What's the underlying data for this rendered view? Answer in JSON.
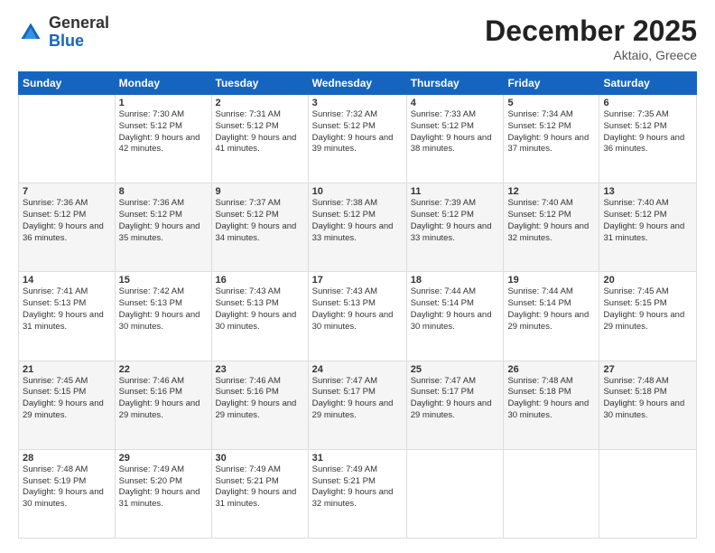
{
  "header": {
    "logo": {
      "general": "General",
      "blue": "Blue"
    },
    "title": "December 2025",
    "location": "Aktaio, Greece"
  },
  "weekdays": [
    "Sunday",
    "Monday",
    "Tuesday",
    "Wednesday",
    "Thursday",
    "Friday",
    "Saturday"
  ],
  "weeks": [
    [
      {
        "day": "",
        "sunrise": "",
        "sunset": "",
        "daylight": ""
      },
      {
        "day": "1",
        "sunrise": "Sunrise: 7:30 AM",
        "sunset": "Sunset: 5:12 PM",
        "daylight": "Daylight: 9 hours and 42 minutes."
      },
      {
        "day": "2",
        "sunrise": "Sunrise: 7:31 AM",
        "sunset": "Sunset: 5:12 PM",
        "daylight": "Daylight: 9 hours and 41 minutes."
      },
      {
        "day": "3",
        "sunrise": "Sunrise: 7:32 AM",
        "sunset": "Sunset: 5:12 PM",
        "daylight": "Daylight: 9 hours and 39 minutes."
      },
      {
        "day": "4",
        "sunrise": "Sunrise: 7:33 AM",
        "sunset": "Sunset: 5:12 PM",
        "daylight": "Daylight: 9 hours and 38 minutes."
      },
      {
        "day": "5",
        "sunrise": "Sunrise: 7:34 AM",
        "sunset": "Sunset: 5:12 PM",
        "daylight": "Daylight: 9 hours and 37 minutes."
      },
      {
        "day": "6",
        "sunrise": "Sunrise: 7:35 AM",
        "sunset": "Sunset: 5:12 PM",
        "daylight": "Daylight: 9 hours and 36 minutes."
      }
    ],
    [
      {
        "day": "7",
        "sunrise": "Sunrise: 7:36 AM",
        "sunset": "Sunset: 5:12 PM",
        "daylight": "Daylight: 9 hours and 36 minutes."
      },
      {
        "day": "8",
        "sunrise": "Sunrise: 7:36 AM",
        "sunset": "Sunset: 5:12 PM",
        "daylight": "Daylight: 9 hours and 35 minutes."
      },
      {
        "day": "9",
        "sunrise": "Sunrise: 7:37 AM",
        "sunset": "Sunset: 5:12 PM",
        "daylight": "Daylight: 9 hours and 34 minutes."
      },
      {
        "day": "10",
        "sunrise": "Sunrise: 7:38 AM",
        "sunset": "Sunset: 5:12 PM",
        "daylight": "Daylight: 9 hours and 33 minutes."
      },
      {
        "day": "11",
        "sunrise": "Sunrise: 7:39 AM",
        "sunset": "Sunset: 5:12 PM",
        "daylight": "Daylight: 9 hours and 33 minutes."
      },
      {
        "day": "12",
        "sunrise": "Sunrise: 7:40 AM",
        "sunset": "Sunset: 5:12 PM",
        "daylight": "Daylight: 9 hours and 32 minutes."
      },
      {
        "day": "13",
        "sunrise": "Sunrise: 7:40 AM",
        "sunset": "Sunset: 5:12 PM",
        "daylight": "Daylight: 9 hours and 31 minutes."
      }
    ],
    [
      {
        "day": "14",
        "sunrise": "Sunrise: 7:41 AM",
        "sunset": "Sunset: 5:13 PM",
        "daylight": "Daylight: 9 hours and 31 minutes."
      },
      {
        "day": "15",
        "sunrise": "Sunrise: 7:42 AM",
        "sunset": "Sunset: 5:13 PM",
        "daylight": "Daylight: 9 hours and 30 minutes."
      },
      {
        "day": "16",
        "sunrise": "Sunrise: 7:43 AM",
        "sunset": "Sunset: 5:13 PM",
        "daylight": "Daylight: 9 hours and 30 minutes."
      },
      {
        "day": "17",
        "sunrise": "Sunrise: 7:43 AM",
        "sunset": "Sunset: 5:13 PM",
        "daylight": "Daylight: 9 hours and 30 minutes."
      },
      {
        "day": "18",
        "sunrise": "Sunrise: 7:44 AM",
        "sunset": "Sunset: 5:14 PM",
        "daylight": "Daylight: 9 hours and 30 minutes."
      },
      {
        "day": "19",
        "sunrise": "Sunrise: 7:44 AM",
        "sunset": "Sunset: 5:14 PM",
        "daylight": "Daylight: 9 hours and 29 minutes."
      },
      {
        "day": "20",
        "sunrise": "Sunrise: 7:45 AM",
        "sunset": "Sunset: 5:15 PM",
        "daylight": "Daylight: 9 hours and 29 minutes."
      }
    ],
    [
      {
        "day": "21",
        "sunrise": "Sunrise: 7:45 AM",
        "sunset": "Sunset: 5:15 PM",
        "daylight": "Daylight: 9 hours and 29 minutes."
      },
      {
        "day": "22",
        "sunrise": "Sunrise: 7:46 AM",
        "sunset": "Sunset: 5:16 PM",
        "daylight": "Daylight: 9 hours and 29 minutes."
      },
      {
        "day": "23",
        "sunrise": "Sunrise: 7:46 AM",
        "sunset": "Sunset: 5:16 PM",
        "daylight": "Daylight: 9 hours and 29 minutes."
      },
      {
        "day": "24",
        "sunrise": "Sunrise: 7:47 AM",
        "sunset": "Sunset: 5:17 PM",
        "daylight": "Daylight: 9 hours and 29 minutes."
      },
      {
        "day": "25",
        "sunrise": "Sunrise: 7:47 AM",
        "sunset": "Sunset: 5:17 PM",
        "daylight": "Daylight: 9 hours and 29 minutes."
      },
      {
        "day": "26",
        "sunrise": "Sunrise: 7:48 AM",
        "sunset": "Sunset: 5:18 PM",
        "daylight": "Daylight: 9 hours and 30 minutes."
      },
      {
        "day": "27",
        "sunrise": "Sunrise: 7:48 AM",
        "sunset": "Sunset: 5:18 PM",
        "daylight": "Daylight: 9 hours and 30 minutes."
      }
    ],
    [
      {
        "day": "28",
        "sunrise": "Sunrise: 7:48 AM",
        "sunset": "Sunset: 5:19 PM",
        "daylight": "Daylight: 9 hours and 30 minutes."
      },
      {
        "day": "29",
        "sunrise": "Sunrise: 7:49 AM",
        "sunset": "Sunset: 5:20 PM",
        "daylight": "Daylight: 9 hours and 31 minutes."
      },
      {
        "day": "30",
        "sunrise": "Sunrise: 7:49 AM",
        "sunset": "Sunset: 5:21 PM",
        "daylight": "Daylight: 9 hours and 31 minutes."
      },
      {
        "day": "31",
        "sunrise": "Sunrise: 7:49 AM",
        "sunset": "Sunset: 5:21 PM",
        "daylight": "Daylight: 9 hours and 32 minutes."
      },
      {
        "day": "",
        "sunrise": "",
        "sunset": "",
        "daylight": ""
      },
      {
        "day": "",
        "sunrise": "",
        "sunset": "",
        "daylight": ""
      },
      {
        "day": "",
        "sunrise": "",
        "sunset": "",
        "daylight": ""
      }
    ]
  ]
}
